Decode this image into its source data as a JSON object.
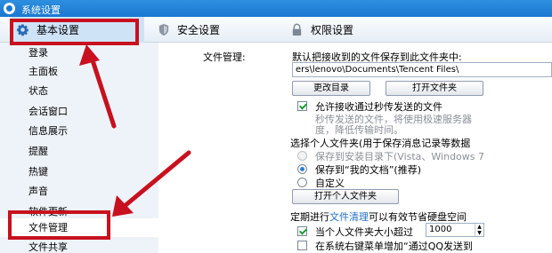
{
  "window": {
    "title": "系统设置"
  },
  "tabs": [
    {
      "label": "基本设置",
      "icon": "gear-icon"
    },
    {
      "label": "安全设置",
      "icon": "shield-icon"
    },
    {
      "label": "权限设置",
      "icon": "lock-icon"
    }
  ],
  "sidebar": {
    "items": [
      {
        "label": "登录"
      },
      {
        "label": "主面板"
      },
      {
        "label": "状态"
      },
      {
        "label": "会话窗口"
      },
      {
        "label": "信息展示"
      },
      {
        "label": "提醒"
      },
      {
        "label": "热键"
      },
      {
        "label": "声音"
      },
      {
        "label": "软件更新"
      },
      {
        "label": "文件管理"
      },
      {
        "label": "文件共享"
      }
    ],
    "selected": "文件管理"
  },
  "file_management": {
    "section_label": "文件管理:",
    "save_to_label": "默认把接收到的文件保存到此文件夹中:",
    "path_value": "ers\\lenovo\\Documents\\Tencent Files\\",
    "change_dir_button": "更改目录",
    "open_folder_button": "打开文件夹",
    "allow_transfer_label": "允许接收通过秒传发送的文件",
    "allow_transfer_desc1": "秒传发送的文件，将使用极速服务器",
    "allow_transfer_desc2": "度，降低传输时间。",
    "personal_folder_heading": "选择个人文件夹(用于保存消息记录等数据",
    "radio_install_dir": "保存到安装目录下(Vista、Windows 7",
    "radio_my_documents": "保存到“我的文档”(推荐)",
    "radio_custom": "自定义",
    "open_personal_button": "打开个人文件夹",
    "cleanup_prefix": "定期进行",
    "cleanup_link": "文件清理",
    "cleanup_suffix": "可以有效节省硬盘空间",
    "size_limit_label": "当个人文件夹大小超过",
    "size_limit_value": "1000",
    "context_menu_label": "在系统右键菜单增加“通过QQ发送到"
  },
  "annotations": {
    "highlight_color": "#c8101e"
  }
}
